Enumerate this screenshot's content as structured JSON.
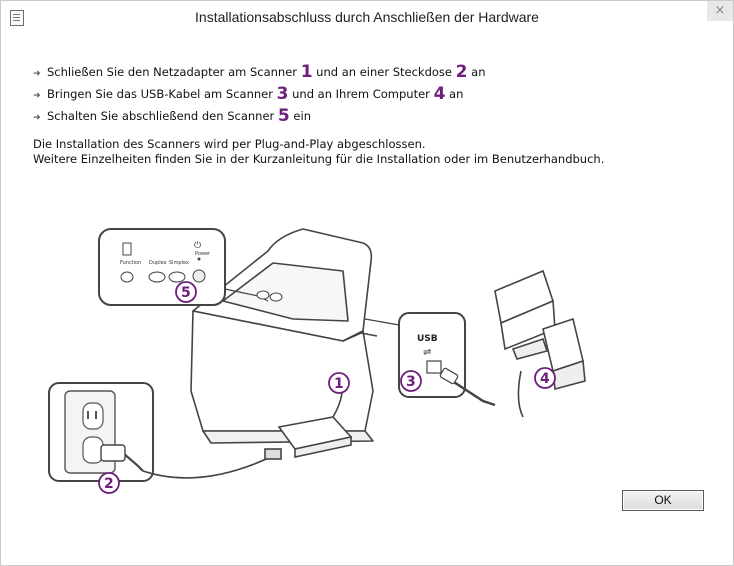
{
  "window": {
    "title": "Installationsabschluss durch Anschließen der Hardware",
    "close_symbol": "×",
    "app_icon": "document-icon"
  },
  "steps": [
    {
      "before": "Schließen Sie den Netzadapter am Scanner ",
      "n1": "1",
      "middle": " und an einer Steckdose ",
      "n2": "2",
      "after": " an"
    },
    {
      "before": "Bringen Sie das USB-Kabel am Scanner ",
      "n1": "3",
      "middle": " und an Ihrem Computer ",
      "n2": "4",
      "after": " an"
    },
    {
      "before": "Schalten Sie abschließend den Scanner ",
      "n1": "5",
      "after": " ein"
    }
  ],
  "description": {
    "line1": "Die Installation des Scanners wird per Plug-and-Play abgeschlossen.",
    "line2": "Weitere Einzelheiten finden Sie in der Kurzanleitung für die Installation oder im Benutzerhandbuch."
  },
  "illustration": {
    "panel_buttons": {
      "function": "Function",
      "duplex": "Duplex",
      "simplex": "Simplex",
      "power": "Power"
    },
    "usb_label": "USB",
    "callouts": [
      "1",
      "2",
      "3",
      "4",
      "5"
    ]
  },
  "buttons": {
    "ok": "OK"
  },
  "colors": {
    "accent": "#6d1f7b",
    "close_bg": "#e8e8e8"
  }
}
